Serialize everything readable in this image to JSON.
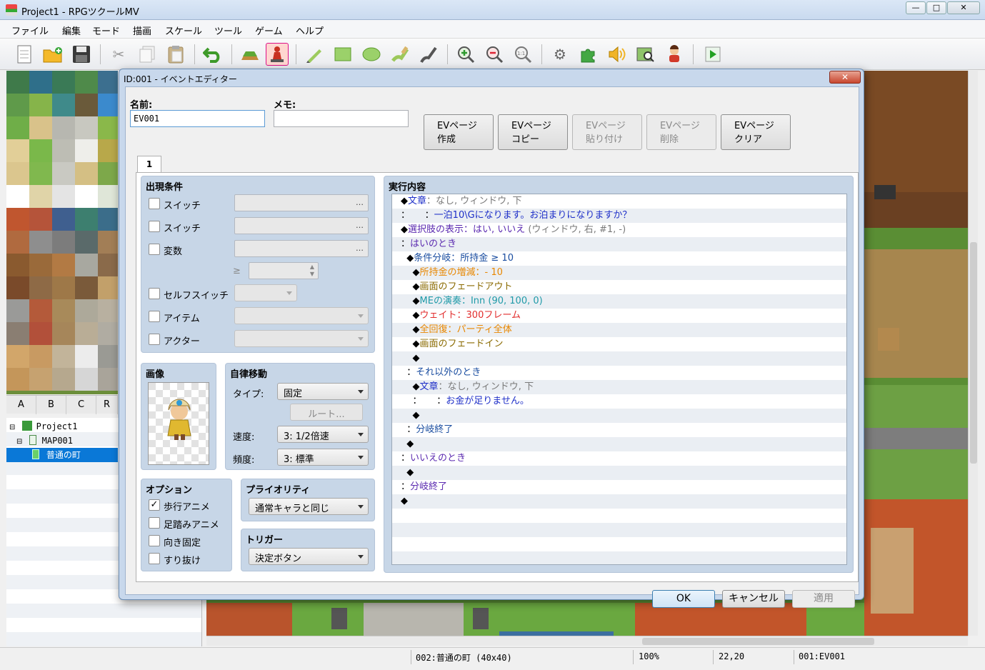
{
  "window": {
    "title": "Project1 - RPGツクールMV",
    "minimize": "—",
    "maximize": "□",
    "close": "✕"
  },
  "menu": [
    "ファイル",
    "編集",
    "モード",
    "描画",
    "スケール",
    "ツール",
    "ゲーム",
    "ヘルプ"
  ],
  "toolbar": {
    "icons": [
      "new-project-icon",
      "open-project-icon",
      "save-icon",
      "cut-icon",
      "copy-icon",
      "paste-icon",
      "undo-icon",
      "map-mode-icon",
      "event-mode-icon",
      "pencil-icon",
      "rectangle-icon",
      "ellipse-icon",
      "fill-icon",
      "shadow-pen-icon",
      "zoom-in-icon",
      "zoom-out-icon",
      "actual-size-icon",
      "database-icon",
      "plugin-manager-icon",
      "sound-test-icon",
      "event-search-icon",
      "character-generator-icon",
      "playtest-icon"
    ]
  },
  "palette": {
    "tabs": [
      "A",
      "B",
      "C",
      "R"
    ]
  },
  "maptree": {
    "items": [
      {
        "label": "Project1",
        "indent": 0
      },
      {
        "label": "MAP001",
        "indent": 1
      },
      {
        "label": "普通の町",
        "indent": 2,
        "selected": true
      }
    ]
  },
  "status": {
    "map": "002:普通の町 (40x40)",
    "zoom": "100%",
    "coords": "22,20",
    "event": "001:EV001"
  },
  "dialog": {
    "title": "ID:001 - イベントエディター",
    "close": "✕",
    "name_label": "名前:",
    "name_value": "EV001",
    "memo_label": "メモ:",
    "memo_value": "",
    "page_buttons": [
      {
        "label": "EVページ\n作成",
        "enabled": true
      },
      {
        "label": "EVページ\nコピー",
        "enabled": true
      },
      {
        "label": "EVページ\n貼り付け",
        "enabled": false
      },
      {
        "label": "EVページ\n削除",
        "enabled": false
      },
      {
        "label": "EVページ\nクリア",
        "enabled": true
      }
    ],
    "page_tab": "1",
    "conditions": {
      "title": "出現条件",
      "switch1": "スイッチ",
      "switch2": "スイッチ",
      "variable": "変数",
      "gte": "≥",
      "self_switch": "セルフスイッチ",
      "item": "アイテム",
      "actor": "アクター",
      "dots": "…"
    },
    "image": {
      "title": "画像"
    },
    "autonomous": {
      "title": "自律移動",
      "type_label": "タイプ:",
      "type_value": "固定",
      "route_button": "ルート...",
      "speed_label": "速度:",
      "speed_value": "3: 1/2倍速",
      "freq_label": "頻度:",
      "freq_value": "3: 標準"
    },
    "options": {
      "title": "オプション",
      "walking": "歩行アニメ",
      "stepping": "足踏みアニメ",
      "direction_fix": "向き固定",
      "through": "すり抜け",
      "walking_checked": "✓"
    },
    "priority": {
      "title": "プライオリティ",
      "value": "通常キャラと同じ"
    },
    "trigger": {
      "title": "トリガー",
      "value": "決定ボタン"
    },
    "contents": {
      "title": "実行内容",
      "lines": [
        [
          {
            "t": "◆",
            "c": ""
          },
          {
            "t": "文章",
            "c": "blue"
          },
          {
            "t": "：なし, ウィンドウ, 下",
            "c": "gray"
          }
        ],
        [
          {
            "t": "：     ：",
            "c": ""
          },
          {
            "t": "一泊10\\Gになります。お泊まりになりますか？",
            "c": "blue"
          }
        ],
        [
          {
            "t": "◆",
            "c": ""
          },
          {
            "t": "選択肢の表示：はい, いいえ",
            "c": "purple"
          },
          {
            "t": " (ウィンドウ, 右, #1, -)",
            "c": "gray"
          }
        ],
        [
          {
            "t": "：",
            "c": ""
          },
          {
            "t": "はいのとき",
            "c": "purple"
          }
        ],
        [
          {
            "t": "  ◆",
            "c": ""
          },
          {
            "t": "条件分岐：所持金 ≥ 10",
            "c": "navy"
          }
        ],
        [
          {
            "t": "    ◆",
            "c": ""
          },
          {
            "t": "所持金の増減：- 10",
            "c": "orange"
          }
        ],
        [
          {
            "t": "    ◆",
            "c": ""
          },
          {
            "t": "画面のフェードアウト",
            "c": "olive"
          }
        ],
        [
          {
            "t": "    ◆",
            "c": ""
          },
          {
            "t": "MEの演奏：Inn (90, 100, 0)",
            "c": "teal"
          }
        ],
        [
          {
            "t": "    ◆",
            "c": ""
          },
          {
            "t": "ウェイト：300フレーム",
            "c": "red"
          }
        ],
        [
          {
            "t": "    ◆",
            "c": ""
          },
          {
            "t": "全回復：パーティ全体",
            "c": "orange"
          }
        ],
        [
          {
            "t": "    ◆",
            "c": ""
          },
          {
            "t": "画面のフェードイン",
            "c": "olive"
          }
        ],
        [
          {
            "t": "    ◆",
            "c": ""
          }
        ],
        [
          {
            "t": "  ：",
            "c": ""
          },
          {
            "t": "それ以外のとき",
            "c": "navy"
          }
        ],
        [
          {
            "t": "    ◆",
            "c": ""
          },
          {
            "t": "文章",
            "c": "blue"
          },
          {
            "t": "：なし, ウィンドウ, 下",
            "c": "gray"
          }
        ],
        [
          {
            "t": "    ：     ：",
            "c": ""
          },
          {
            "t": "お金が足りません。",
            "c": "blue"
          }
        ],
        [
          {
            "t": "    ◆",
            "c": ""
          }
        ],
        [
          {
            "t": "  ：",
            "c": ""
          },
          {
            "t": "分岐終了",
            "c": "navy"
          }
        ],
        [
          {
            "t": "  ◆",
            "c": ""
          }
        ],
        [
          {
            "t": "：",
            "c": ""
          },
          {
            "t": "いいえのとき",
            "c": "purple"
          }
        ],
        [
          {
            "t": "  ◆",
            "c": ""
          }
        ],
        [
          {
            "t": "：",
            "c": ""
          },
          {
            "t": "分岐終了",
            "c": "purple"
          }
        ],
        [
          {
            "t": "◆",
            "c": ""
          }
        ]
      ]
    },
    "ok": "OK",
    "cancel": "キャンセル",
    "apply": "適用"
  }
}
